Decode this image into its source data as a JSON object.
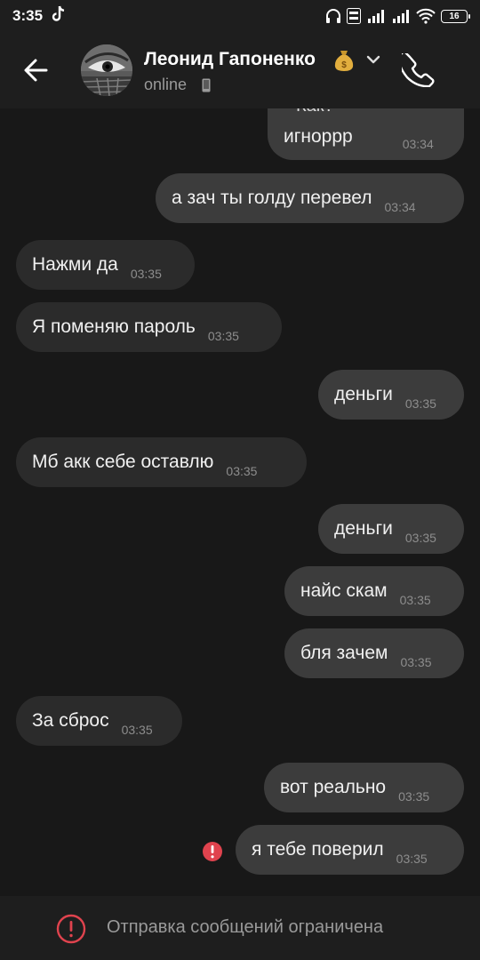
{
  "status_bar": {
    "time": "3:35",
    "battery": "16",
    "icons": [
      "tiktok-icon",
      "headphones-icon",
      "volte-icon",
      "signal-icon",
      "wifi-icon",
      "battery-icon"
    ]
  },
  "header": {
    "contact_name": "Леонид Гапоненко",
    "name_emoji": "money-bag-icon",
    "status": "online"
  },
  "messages": [
    {
      "dir": "out",
      "text": "игноррр",
      "time": "03:34",
      "quote": "Как?"
    },
    {
      "dir": "out",
      "text": "а зач ты голду перевел",
      "time": "03:34"
    },
    {
      "dir": "in",
      "text": "Нажми да",
      "time": "03:35"
    },
    {
      "dir": "in",
      "text": "Я поменяю пароль",
      "time": "03:35"
    },
    {
      "dir": "out",
      "text": "деньги",
      "time": "03:35"
    },
    {
      "dir": "in",
      "text": "Мб акк себе оставлю",
      "time": "03:35"
    },
    {
      "dir": "out",
      "text": "деньги",
      "time": "03:35"
    },
    {
      "dir": "out",
      "text": "найс скам",
      "time": "03:35"
    },
    {
      "dir": "out",
      "text": "бля зачем",
      "time": "03:35"
    },
    {
      "dir": "in",
      "text": "За сброс",
      "time": "03:35"
    },
    {
      "dir": "out",
      "text": "вот реально",
      "time": "03:35"
    },
    {
      "dir": "out",
      "text": "я тебе поверил",
      "time": "03:35",
      "error": true
    }
  ],
  "bottom_bar": {
    "text": "Отправка сообщений ограничена"
  },
  "colors": {
    "background": "#181818",
    "bar": "#1e1e1e",
    "incoming_bubble": "#2b2b2b",
    "outgoing_bubble": "#3c3c3c",
    "error": "#e0434e",
    "quote_accent": "#6c8cd5"
  }
}
